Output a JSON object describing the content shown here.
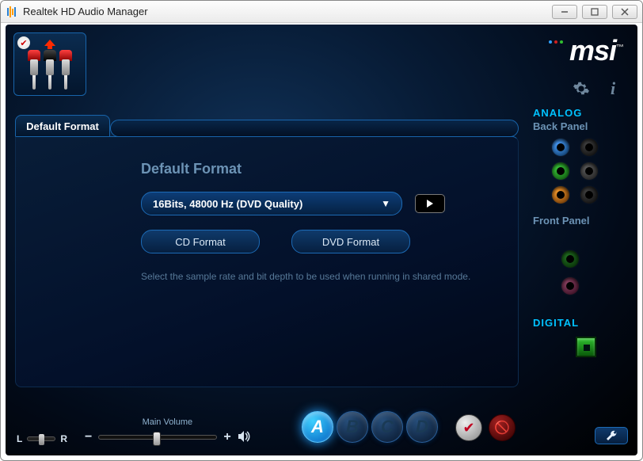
{
  "window": {
    "title": "Realtek HD Audio Manager"
  },
  "brand": "msi",
  "tab": {
    "label": "Default Format"
  },
  "main": {
    "section_title": "Default Format",
    "selected_format": "16Bits, 48000 Hz (DVD Quality)",
    "btn_cd": "CD Format",
    "btn_dvd": "DVD Format",
    "hint": "Select the sample rate and bit depth to be used when running in shared mode."
  },
  "side": {
    "analog": "ANALOG",
    "back_panel": "Back Panel",
    "front_panel": "Front Panel",
    "digital": "DIGITAL"
  },
  "bottom": {
    "L": "L",
    "R": "R",
    "minus": "−",
    "plus": "+",
    "vol_label": "Main Volume",
    "letters": [
      "A",
      "B",
      "C",
      "D"
    ]
  }
}
